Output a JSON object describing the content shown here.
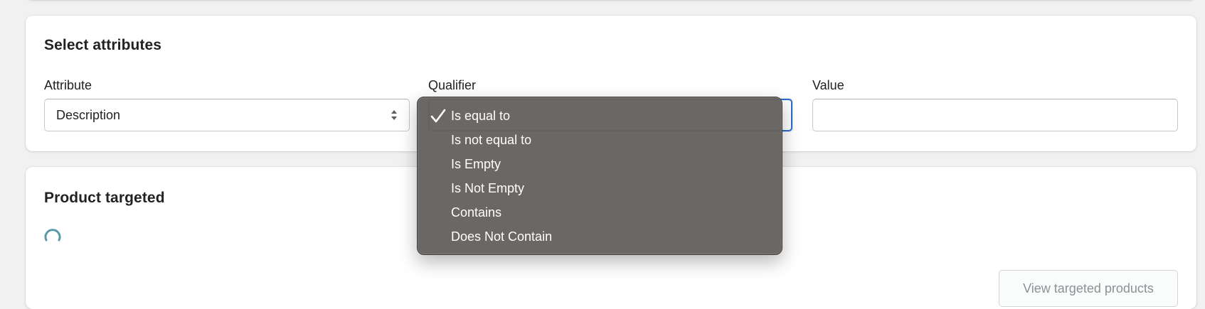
{
  "attributes_card": {
    "title": "Select attributes",
    "attribute": {
      "label": "Attribute",
      "selected": "Description"
    },
    "qualifier": {
      "label": "Qualifier",
      "options": [
        {
          "label": "Is equal to",
          "checked": true
        },
        {
          "label": "Is not equal to",
          "checked": false
        },
        {
          "label": "Is Empty",
          "checked": false
        },
        {
          "label": "Is Not Empty",
          "checked": false
        },
        {
          "label": "Contains",
          "checked": false
        },
        {
          "label": "Does Not Contain",
          "checked": false
        }
      ]
    },
    "value": {
      "label": "Value",
      "current": ""
    }
  },
  "targeted_card": {
    "title": "Product targeted",
    "loading_icon": "spinner-icon",
    "view_button_label": "View targeted products"
  },
  "colors": {
    "focus_border": "#2c6ecb",
    "menu_background": "#666260",
    "spinner": "#5a9aa6",
    "disabled_text": "#8c9196"
  }
}
